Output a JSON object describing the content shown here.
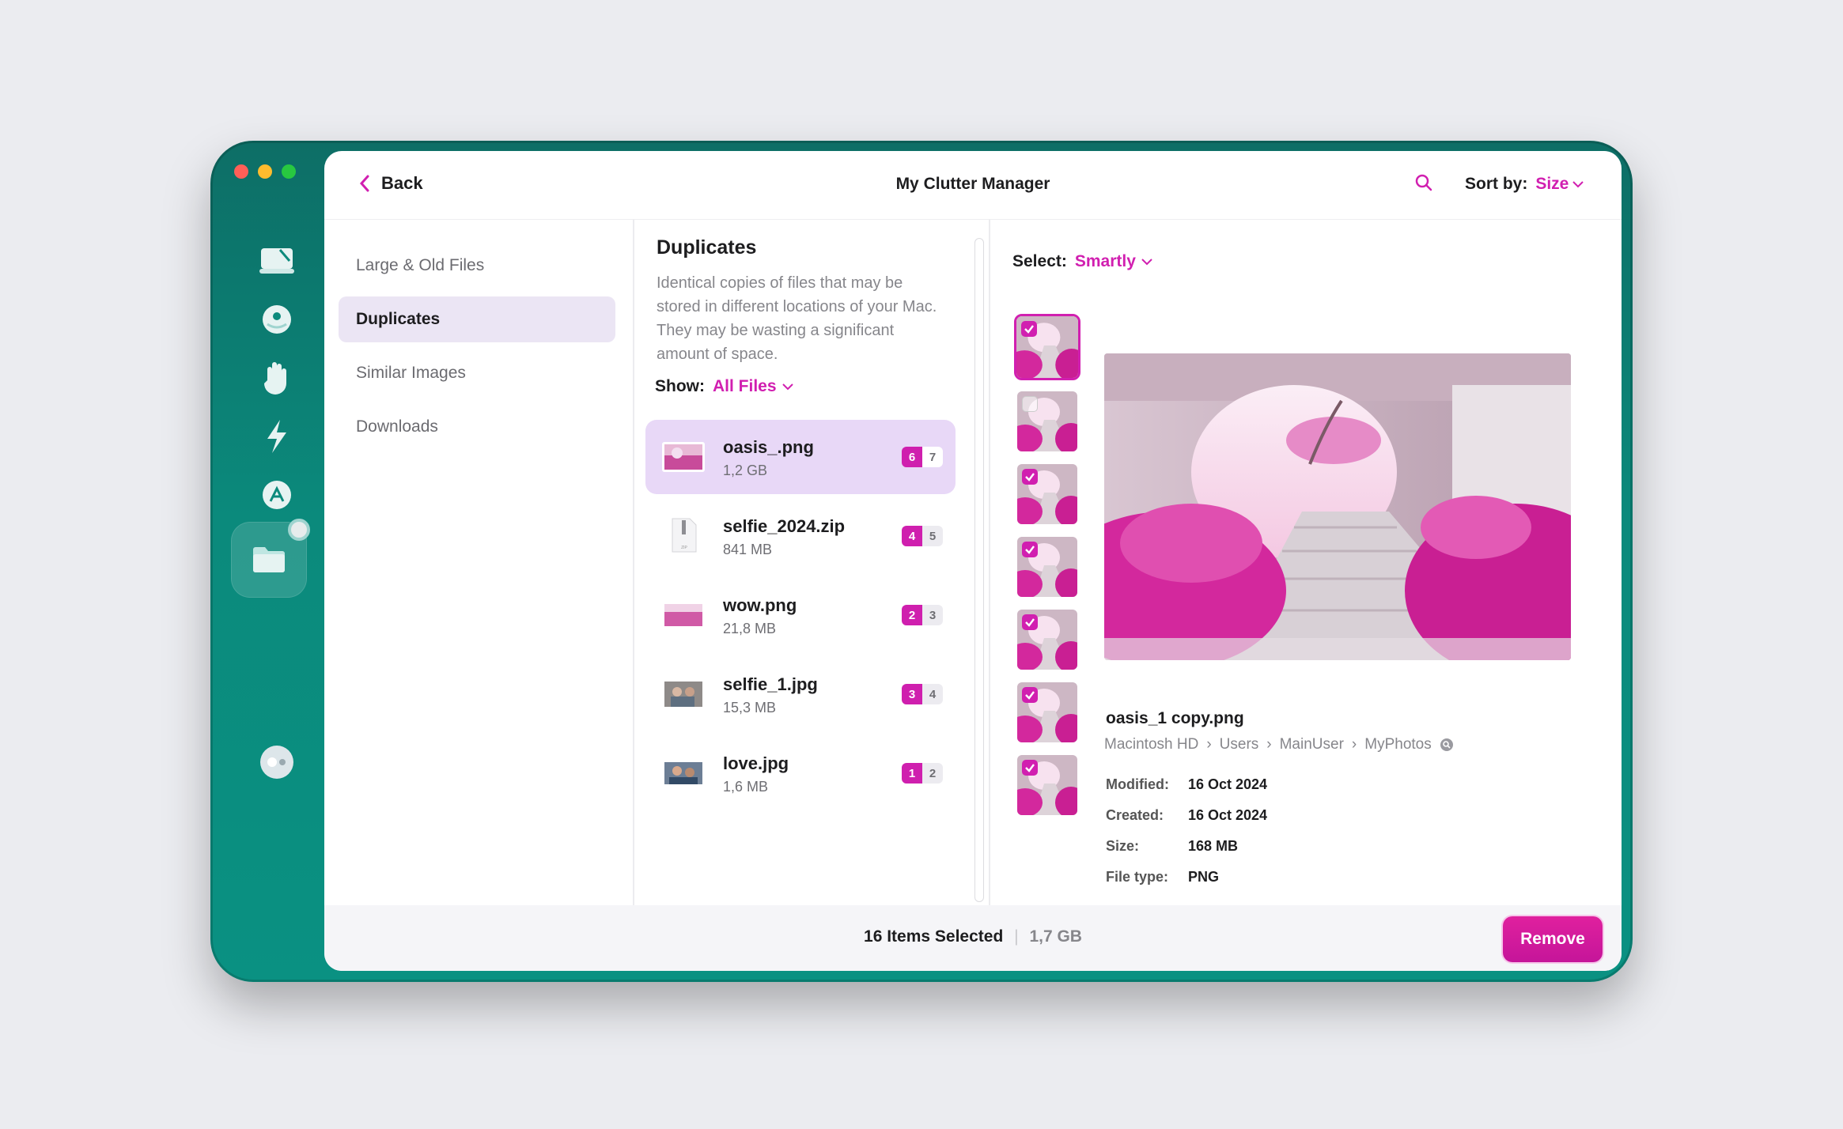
{
  "window": {
    "title": "My Clutter Manager",
    "back_label": "Back"
  },
  "sort": {
    "label": "Sort by:",
    "value": "Size"
  },
  "categories": [
    {
      "label": "Large & Old Files",
      "selected": false
    },
    {
      "label": "Duplicates",
      "selected": true
    },
    {
      "label": "Similar Images",
      "selected": false
    },
    {
      "label": "Downloads",
      "selected": false
    }
  ],
  "list": {
    "heading": "Duplicates",
    "description": "Identical copies of files that may be stored in different locations of your Mac. They may be wasting a significant amount of space.",
    "show_label": "Show:",
    "show_value": "All Files",
    "items": [
      {
        "name": "oasis_.png",
        "size": "1,2 GB",
        "selected_count": "6",
        "total": "7",
        "selected": true,
        "thumb": "pink-image"
      },
      {
        "name": "selfie_2024.zip",
        "size": "841 MB",
        "selected_count": "4",
        "total": "5",
        "selected": false,
        "thumb": "zip-file"
      },
      {
        "name": "wow.png",
        "size": "21,8 MB",
        "selected_count": "2",
        "total": "3",
        "selected": false,
        "thumb": "pink-image"
      },
      {
        "name": "selfie_1.jpg",
        "size": "15,3 MB",
        "selected_count": "3",
        "total": "4",
        "selected": false,
        "thumb": "photo"
      },
      {
        "name": "love.jpg",
        "size": "1,6 MB",
        "selected_count": "1",
        "total": "2",
        "selected": false,
        "thumb": "photo"
      }
    ]
  },
  "detail": {
    "select_label": "Select:",
    "select_value": "Smartly",
    "copies": [
      true,
      false,
      true,
      true,
      true,
      true,
      true
    ],
    "file_name": "oasis_1 copy.png",
    "path": [
      "Macintosh HD",
      "Users",
      "MainUser",
      "MyPhotos"
    ],
    "meta": [
      {
        "key": "Modified:",
        "value": "16 Oct 2024"
      },
      {
        "key": "Created:",
        "value": "16 Oct 2024"
      },
      {
        "key": "Size:",
        "value": "168 MB"
      },
      {
        "key": "File type:",
        "value": "PNG"
      }
    ]
  },
  "footer": {
    "selected_text": "16 Items Selected",
    "selected_size": "1,7 GB",
    "remove_label": "Remove"
  },
  "colors": {
    "accent": "#d11fb0",
    "rail": "#0b8a7c",
    "selected_row": "#e8d8f7"
  }
}
